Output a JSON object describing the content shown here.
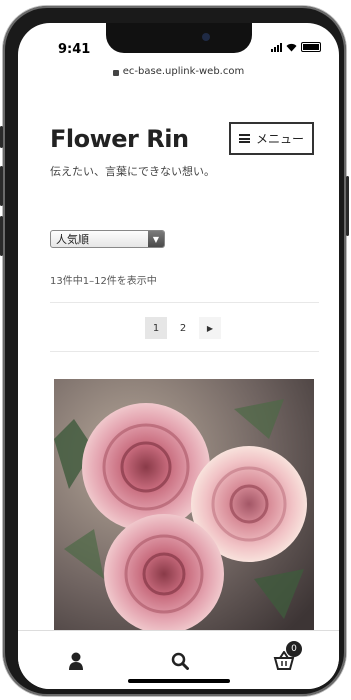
{
  "status_bar": {
    "time": "9:41",
    "url": "ec-base.uplink-web.com"
  },
  "header": {
    "site_title": "Flower Rin",
    "menu_label": "メニュー",
    "tagline": "伝えたい、言葉にできない想い。"
  },
  "shop": {
    "sort_selected": "人気順",
    "result_count": "13件中1–12件を表示中",
    "pagination": {
      "pages": [
        "1",
        "2"
      ],
      "current": "1",
      "next_icon": "arrow-right-icon"
    }
  },
  "bottom_nav": {
    "items": [
      {
        "icon": "user-icon"
      },
      {
        "icon": "search-icon"
      },
      {
        "icon": "cart-icon",
        "badge": "0"
      }
    ]
  },
  "colors": {
    "text": "#222222",
    "tagline": "#444444",
    "border": "#333333"
  }
}
